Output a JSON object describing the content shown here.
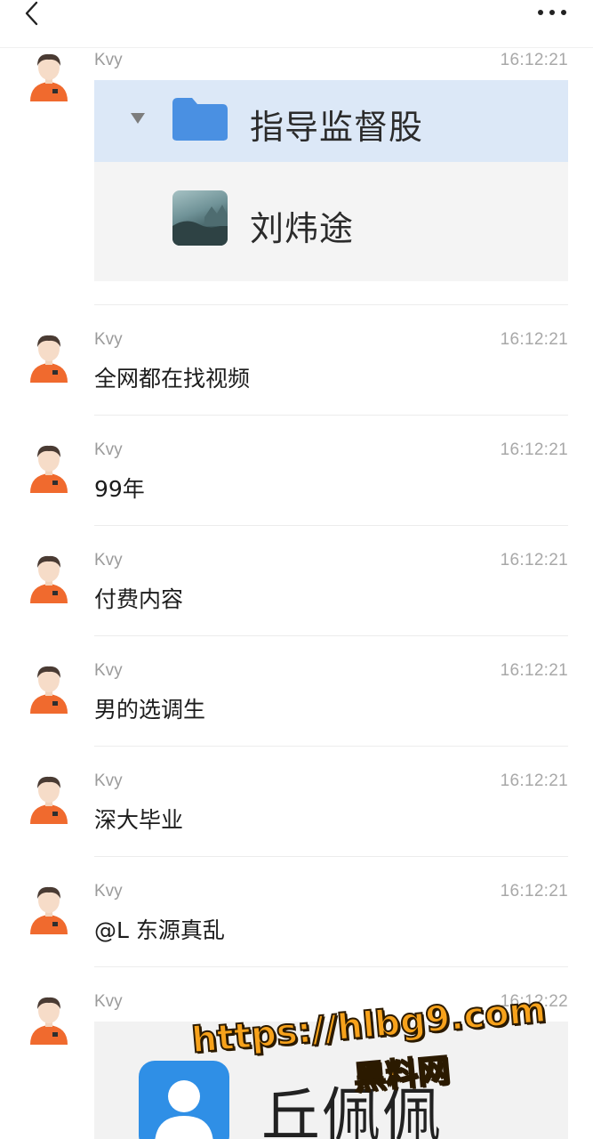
{
  "header": {
    "back_icon": "chevron-left-icon",
    "more_icon": "more-horizontal-icon"
  },
  "messages": [
    {
      "sender": "Kvy",
      "time": "16:12:21",
      "type": "image",
      "image": {
        "folder_label": "指导监督股",
        "contact_label": "刘炜途"
      }
    },
    {
      "sender": "Kvy",
      "time": "16:12:21",
      "type": "text",
      "text": "全网都在找视频"
    },
    {
      "sender": "Kvy",
      "time": "16:12:21",
      "type": "text",
      "text": "99年"
    },
    {
      "sender": "Kvy",
      "time": "16:12:21",
      "type": "text",
      "text": "付费内容"
    },
    {
      "sender": "Kvy",
      "time": "16:12:21",
      "type": "text",
      "text": "男的选调生"
    },
    {
      "sender": "Kvy",
      "time": "16:12:21",
      "type": "text",
      "text": "深大毕业"
    },
    {
      "sender": "Kvy",
      "time": "16:12:21",
      "type": "text",
      "text": "@L 东源真乱"
    },
    {
      "sender": "Kvy",
      "time": "16:12:22",
      "type": "image",
      "image": {
        "contact_label": "丘佩佩"
      }
    }
  ],
  "watermark": {
    "url": "https://hlbg9.com",
    "label": "黑料网"
  },
  "colors": {
    "avatar_shirt": "#f06a2e",
    "folder_blue": "#4a90e2",
    "selected_row": "#dce8f7",
    "watermark": "#f7a21b"
  }
}
